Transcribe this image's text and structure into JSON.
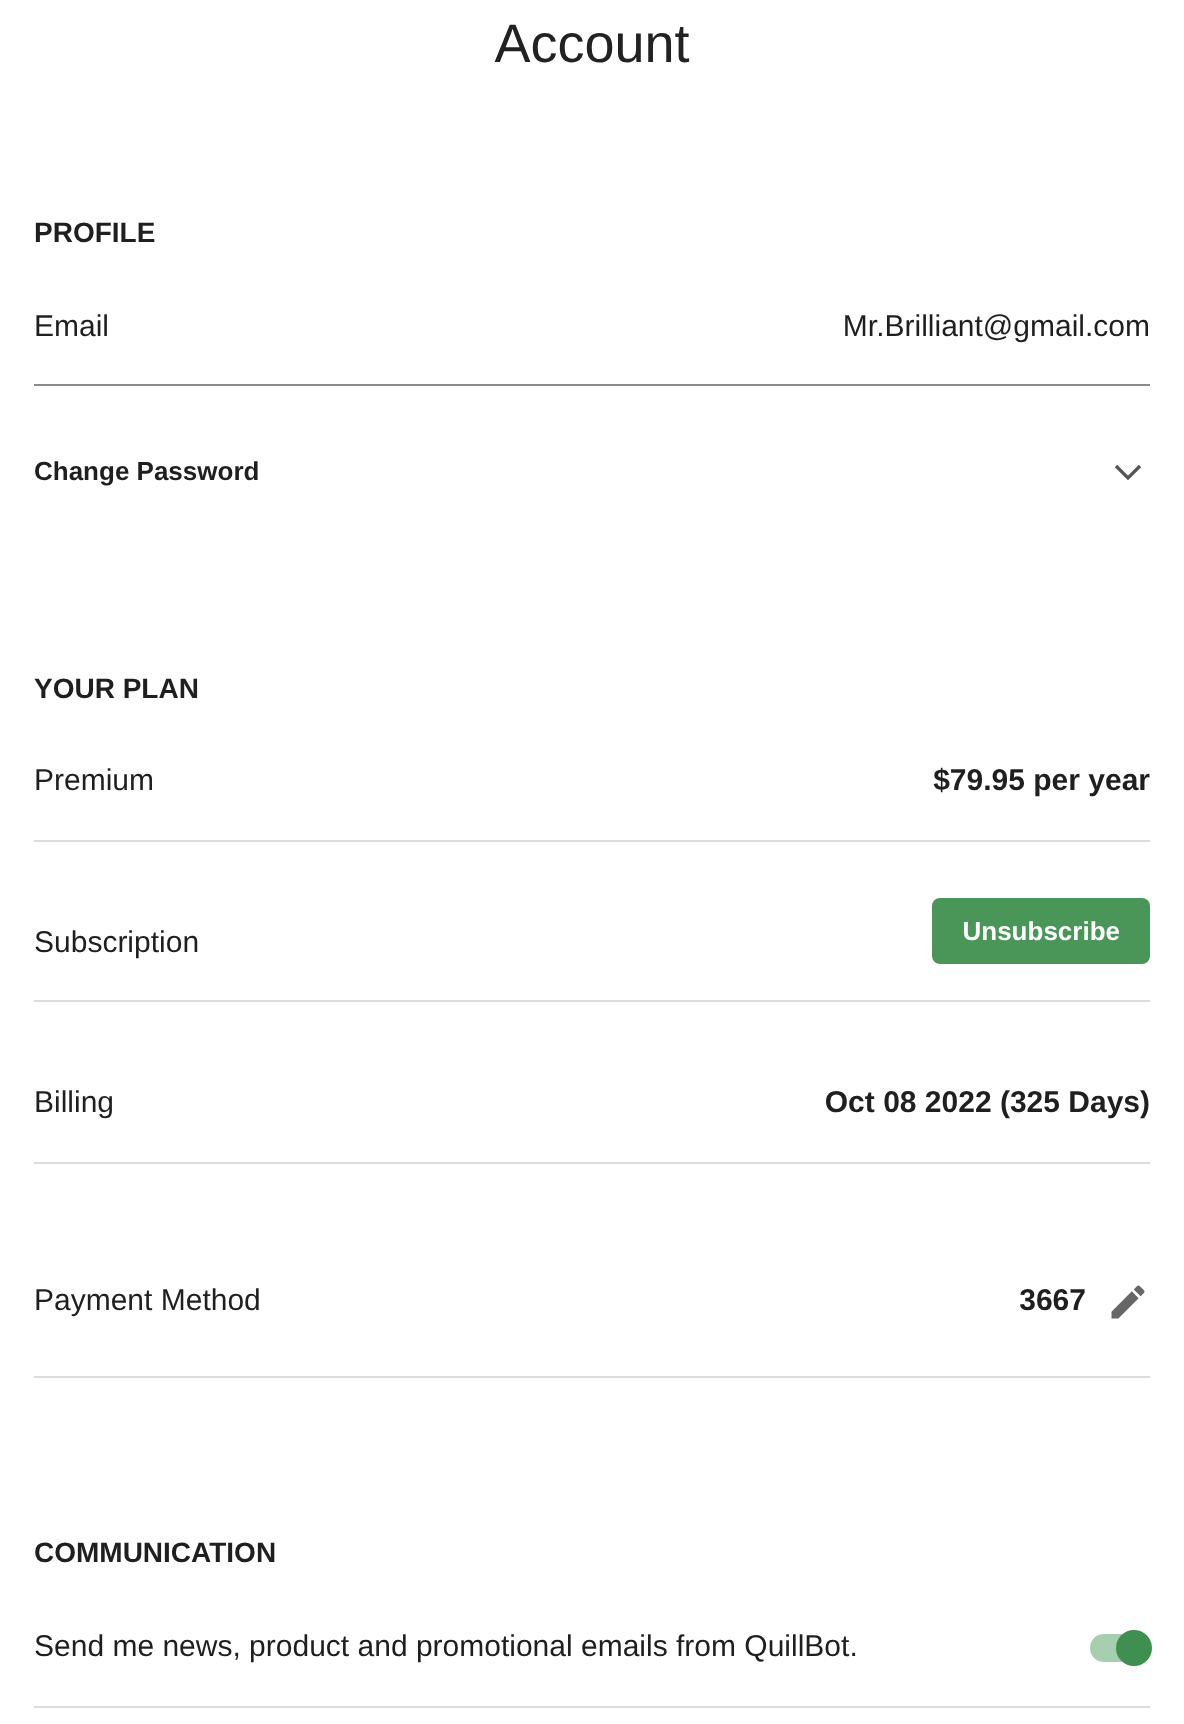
{
  "title": "Account",
  "profile": {
    "heading": "PROFILE",
    "email_label": "Email",
    "email": "Mr.Brilliant@gmail.com",
    "change_password": {
      "label": "Change Password",
      "expanded": false
    }
  },
  "plan": {
    "heading": "YOUR PLAN",
    "rows": [
      {
        "kind": "text",
        "label": "Premium",
        "value": "$79.95 per year"
      },
      {
        "kind": "button",
        "label": "Subscription",
        "value": "Unsubscribe"
      },
      {
        "kind": "text",
        "label": "Billing",
        "value": "Oct 08 2022 (325 Days)"
      },
      {
        "kind": "edit",
        "label": "Payment Method",
        "value": "3667"
      }
    ]
  },
  "communication": {
    "heading": "COMMUNICATION",
    "option": {
      "label": "Send me news, product and promotional emails from QuillBot.",
      "on": true
    }
  }
}
